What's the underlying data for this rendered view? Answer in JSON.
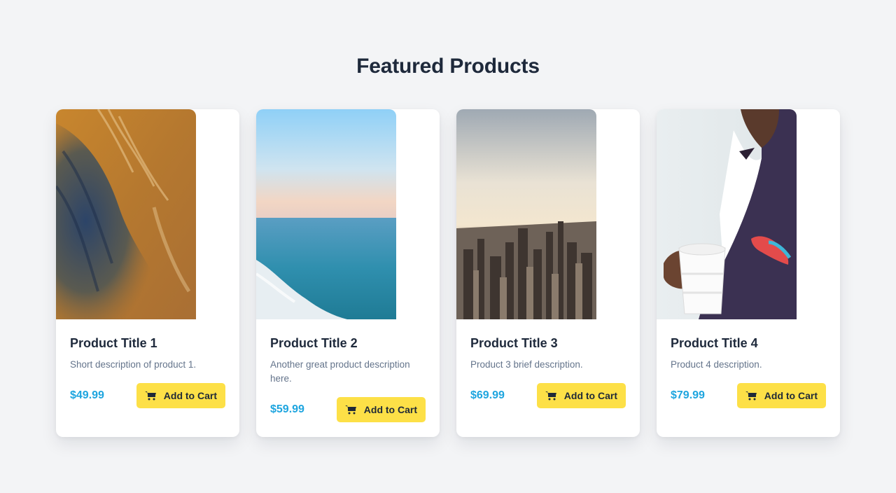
{
  "section": {
    "title": "Featured Products"
  },
  "products": [
    {
      "title": "Product Title 1",
      "description": "Short description of product 1.",
      "price": "$49.99",
      "button_label": "Add to Cart",
      "image": "canyon-aerial-image"
    },
    {
      "title": "Product Title 2",
      "description": "Another great product description here.",
      "price": "$59.99",
      "button_label": "Add to Cart",
      "image": "ocean-horizon-image"
    },
    {
      "title": "Product Title 3",
      "description": "Product 3 brief description.",
      "price": "$69.99",
      "button_label": "Add to Cart",
      "image": "city-skyline-image"
    },
    {
      "title": "Product Title 4",
      "description": "Product 4 description.",
      "price": "$79.99",
      "button_label": "Add to Cart",
      "image": "man-with-cup-image"
    }
  ],
  "icons": {
    "cart": "cart-icon"
  },
  "colors": {
    "background": "#f3f4f6",
    "price": "#1ea5df",
    "button": "#fde047",
    "title": "#1e293b"
  }
}
